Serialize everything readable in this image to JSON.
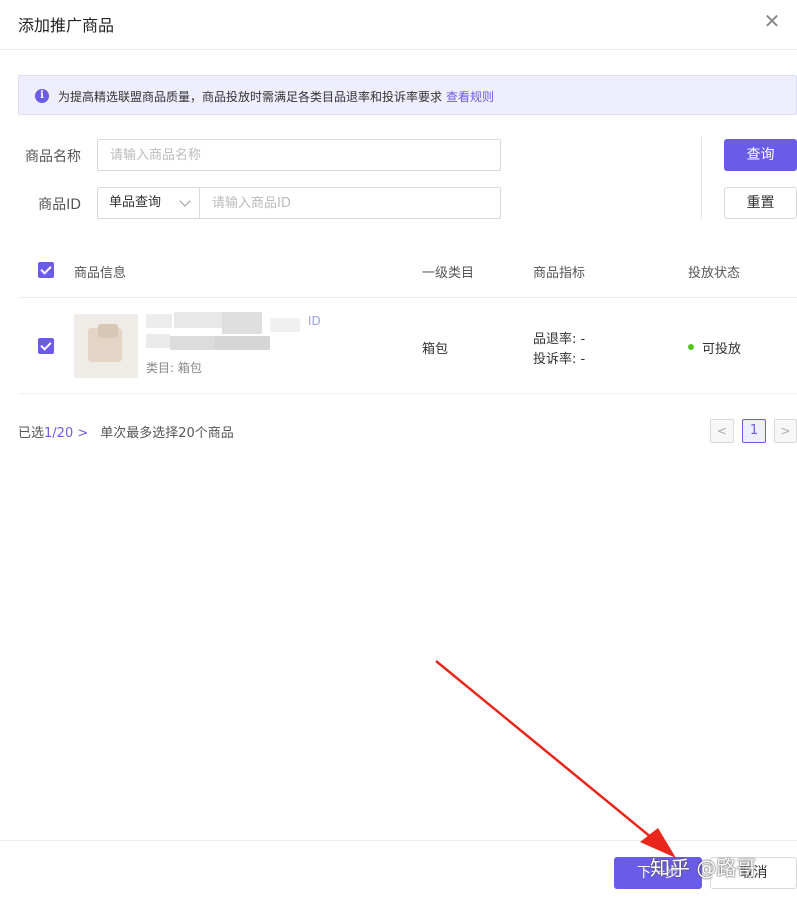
{
  "dialog": {
    "title": "添加推广商品"
  },
  "notice": {
    "text": "为提高精选联盟商品质量，商品投放时需满足各类目品退率和投诉率要求",
    "link": "查看规则"
  },
  "form": {
    "name_label": "商品名称",
    "name_placeholder": "请输入商品名称",
    "id_label": "商品ID",
    "id_mode": "单品查询",
    "id_placeholder": "请输入商品ID",
    "query_label": "查询",
    "reset_label": "重置"
  },
  "table": {
    "headers": [
      "商品信息",
      "一级类目",
      "商品指标",
      "投放状态"
    ],
    "rows": [
      {
        "category_line": "类目: 箱包",
        "category": "箱包",
        "return_rate": "品退率: -",
        "complaint_rate": "投诉率: -",
        "status": "可投放",
        "tag": "ID"
      }
    ]
  },
  "selection": {
    "prefix": "已选",
    "count": "1/20",
    "suffix": ">",
    "limit": "单次最多选择20个商品"
  },
  "pagination": {
    "prev": "<",
    "current": "1",
    "next": ">"
  },
  "footer": {
    "next_label": "下一步",
    "cancel_label": "取消"
  },
  "watermark": "知乎 @路哥",
  "colors": {
    "accent": "#6b5ce7",
    "status_ok": "#52c41a",
    "annotation_arrow": "#e8261c"
  }
}
